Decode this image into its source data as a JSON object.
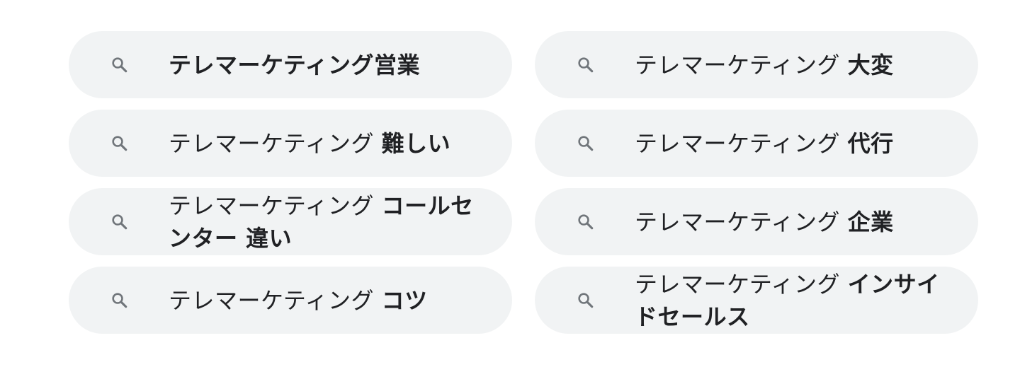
{
  "related_searches": [
    {
      "base": "テレマーケティング",
      "bold": "営業",
      "sep": "",
      "all_bold": true
    },
    {
      "base": "テレマーケティング",
      "bold": "大変",
      "sep": " "
    },
    {
      "base": "テレマーケティング",
      "bold": "難しい",
      "sep": " "
    },
    {
      "base": "テレマーケティング",
      "bold": "代行",
      "sep": " "
    },
    {
      "base": "テレマーケティング",
      "bold": "コールセンター 違い",
      "sep": " "
    },
    {
      "base": "テレマーケティング",
      "bold": "企業",
      "sep": " "
    },
    {
      "base": "テレマーケティング",
      "bold": "コツ",
      "sep": " "
    },
    {
      "base": "テレマーケティング",
      "bold": "インサイドセールス",
      "sep": " "
    }
  ],
  "icons": {
    "chip_icon": "search-icon"
  },
  "colors": {
    "chip_bg": "#f1f3f4",
    "text": "#202124",
    "icon": "#70757a"
  }
}
